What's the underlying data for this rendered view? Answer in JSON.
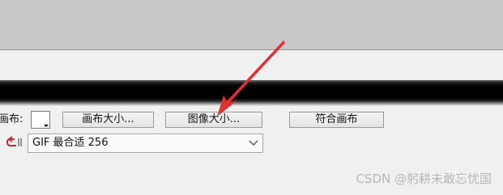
{
  "fields": {
    "canvas_label": "画布:",
    "loop_label": "↩"
  },
  "buttons": {
    "canvas_size": "画布大小...",
    "image_size": "图像大小...",
    "fit_canvas": "符合画布"
  },
  "format_select": {
    "value": "GIF 最合适 256"
  },
  "watermark": {
    "text": "CSDN @躬耕未敢忘忧国"
  },
  "colors": {
    "arrow": "#e03030",
    "icon": "#c03030"
  },
  "icons": {
    "loop": "loop-arrow-icon",
    "dropdown": "chevron-down-icon",
    "annotation": "red-pointer-arrow"
  }
}
